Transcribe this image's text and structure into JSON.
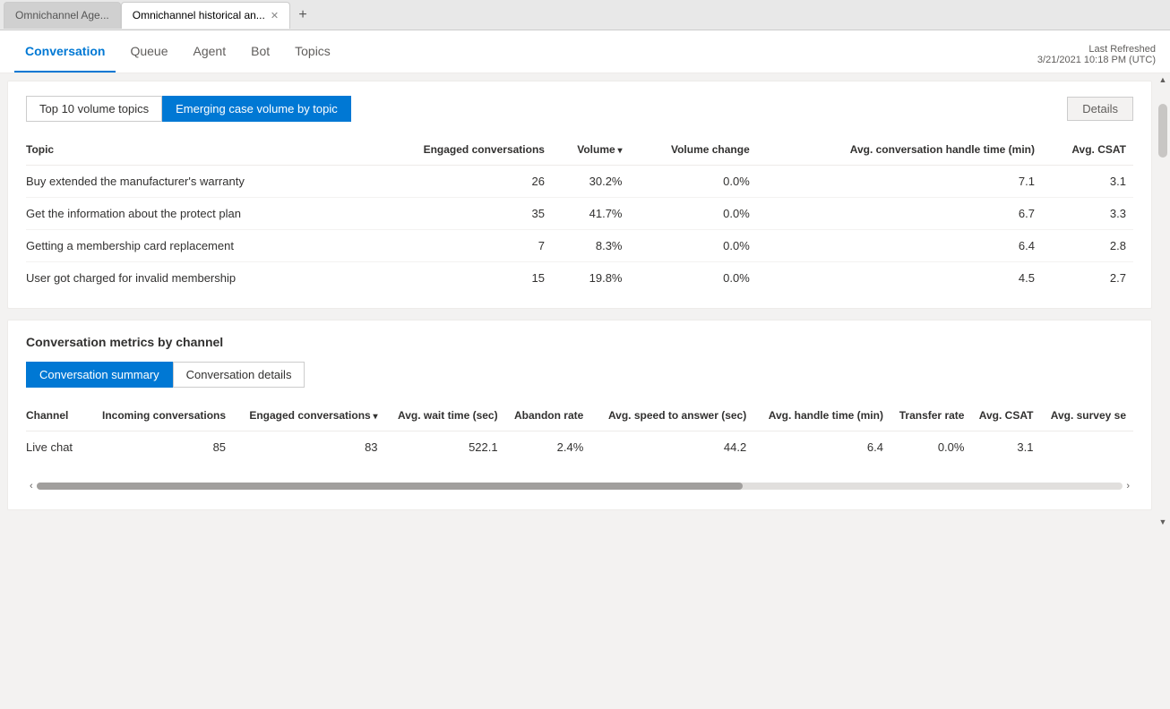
{
  "browser": {
    "tabs": [
      {
        "id": "tab1",
        "label": "Omnichannel Age...",
        "active": false
      },
      {
        "id": "tab2",
        "label": "Omnichannel historical an...",
        "active": true
      }
    ],
    "new_tab_label": "+"
  },
  "app_nav": {
    "tabs": [
      {
        "id": "conversation",
        "label": "Conversation",
        "active": true
      },
      {
        "id": "queue",
        "label": "Queue",
        "active": false
      },
      {
        "id": "agent",
        "label": "Agent",
        "active": false
      },
      {
        "id": "bot",
        "label": "Bot",
        "active": false
      },
      {
        "id": "topics",
        "label": "Topics",
        "active": false
      }
    ],
    "last_refreshed_label": "Last Refreshed",
    "last_refreshed_value": "3/21/2021 10:18 PM (UTC)"
  },
  "topics_card": {
    "topic_tabs": [
      {
        "id": "top10",
        "label": "Top 10 volume topics",
        "active": false
      },
      {
        "id": "emerging",
        "label": "Emerging case volume by topic",
        "active": true
      }
    ],
    "details_button_label": "Details",
    "table_headers": [
      {
        "id": "topic",
        "label": "Topic",
        "sortable": false
      },
      {
        "id": "engaged",
        "label": "Engaged conversations",
        "sortable": false
      },
      {
        "id": "volume",
        "label": "Volume",
        "sortable": true
      },
      {
        "id": "volume_change",
        "label": "Volume change",
        "sortable": false
      },
      {
        "id": "avg_handle",
        "label": "Avg. conversation handle time (min)",
        "sortable": false
      },
      {
        "id": "avg_csat",
        "label": "Avg. CSAT",
        "sortable": false
      }
    ],
    "rows": [
      {
        "topic": "Buy extended the manufacturer's warranty",
        "engaged": "26",
        "volume": "30.2%",
        "volume_change": "0.0%",
        "avg_handle": "7.1",
        "avg_csat": "3.1"
      },
      {
        "topic": "Get the information about the protect plan",
        "engaged": "35",
        "volume": "41.7%",
        "volume_change": "0.0%",
        "avg_handle": "6.7",
        "avg_csat": "3.3"
      },
      {
        "topic": "Getting a membership card replacement",
        "engaged": "7",
        "volume": "8.3%",
        "volume_change": "0.0%",
        "avg_handle": "6.4",
        "avg_csat": "2.8"
      },
      {
        "topic": "User got charged for invalid membership",
        "engaged": "15",
        "volume": "19.8%",
        "volume_change": "0.0%",
        "avg_handle": "4.5",
        "avg_csat": "2.7"
      }
    ]
  },
  "metrics_card": {
    "section_title": "Conversation metrics by channel",
    "inner_tabs": [
      {
        "id": "summary",
        "label": "Conversation summary",
        "active": true
      },
      {
        "id": "details",
        "label": "Conversation details",
        "active": false
      }
    ],
    "table_headers": [
      {
        "id": "channel",
        "label": "Channel",
        "sortable": false
      },
      {
        "id": "incoming",
        "label": "Incoming conversations",
        "sortable": false
      },
      {
        "id": "engaged",
        "label": "Engaged conversations",
        "sortable": true
      },
      {
        "id": "avg_wait",
        "label": "Avg. wait time (sec)",
        "sortable": false
      },
      {
        "id": "abandon",
        "label": "Abandon rate",
        "sortable": false
      },
      {
        "id": "avg_speed",
        "label": "Avg. speed to answer (sec)",
        "sortable": false
      },
      {
        "id": "avg_handle",
        "label": "Avg. handle time (min)",
        "sortable": false
      },
      {
        "id": "transfer",
        "label": "Transfer rate",
        "sortable": false
      },
      {
        "id": "avg_csat",
        "label": "Avg. CSAT",
        "sortable": false
      },
      {
        "id": "avg_survey",
        "label": "Avg. survey se",
        "sortable": false
      }
    ],
    "rows": [
      {
        "channel": "Live chat",
        "incoming": "85",
        "engaged": "83",
        "avg_wait": "522.1",
        "abandon": "2.4%",
        "avg_speed": "44.2",
        "avg_handle": "6.4",
        "transfer": "0.0%",
        "avg_csat": "3.1",
        "avg_survey": ""
      }
    ]
  },
  "colors": {
    "active_blue": "#0078d4",
    "text_dark": "#323130",
    "text_medium": "#605e5c",
    "border": "#edebe9",
    "bg_light": "#f3f2f1"
  }
}
